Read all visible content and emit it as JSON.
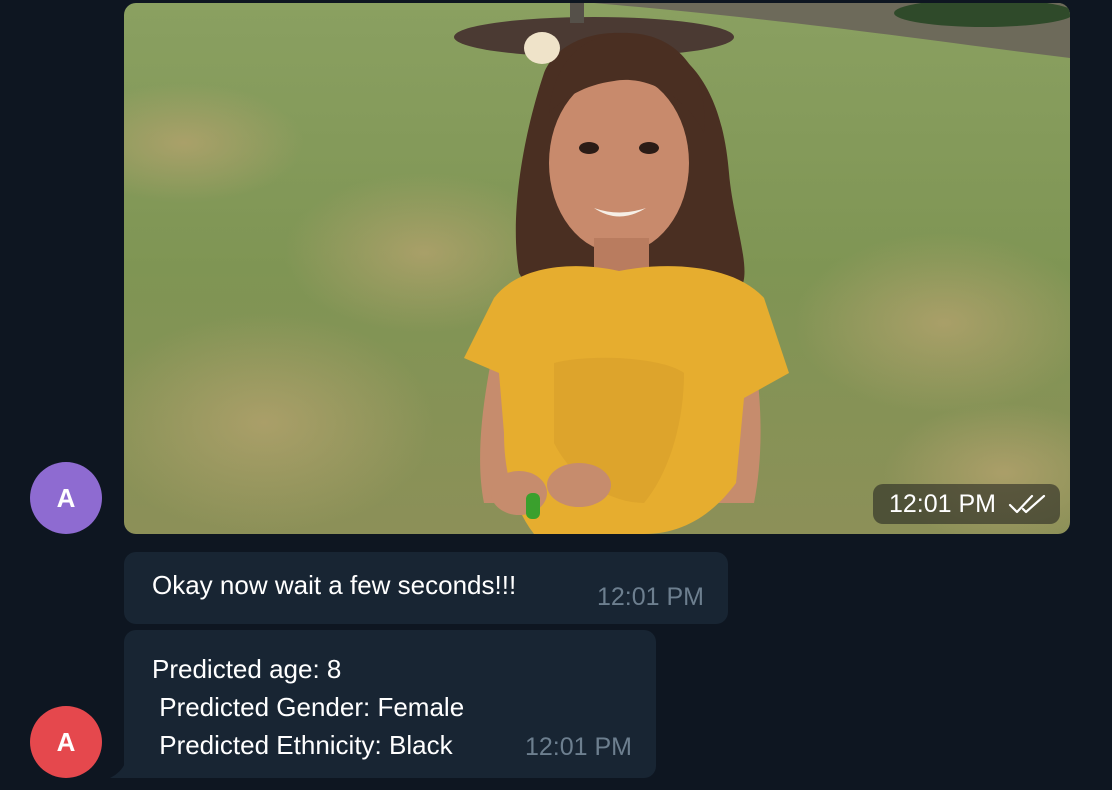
{
  "messages": [
    {
      "type": "photo",
      "avatar_letter": "A",
      "avatar_color": "#8e6bd1",
      "time": "12:01 PM",
      "status_icon": "double-check-icon"
    },
    {
      "type": "text",
      "text": "Okay now wait a few seconds!!!",
      "time": "12:01 PM"
    },
    {
      "type": "text",
      "avatar_letter": "A",
      "avatar_color": "#e5484d",
      "lines": [
        "Predicted age: 8",
        " Predicted Gender: Female",
        " Predicted Ethnicity: Black"
      ],
      "time": "12:01 PM"
    }
  ],
  "colors": {
    "background": "#0e1621",
    "bubble": "#182533",
    "time_text": "#6d7f8f"
  }
}
